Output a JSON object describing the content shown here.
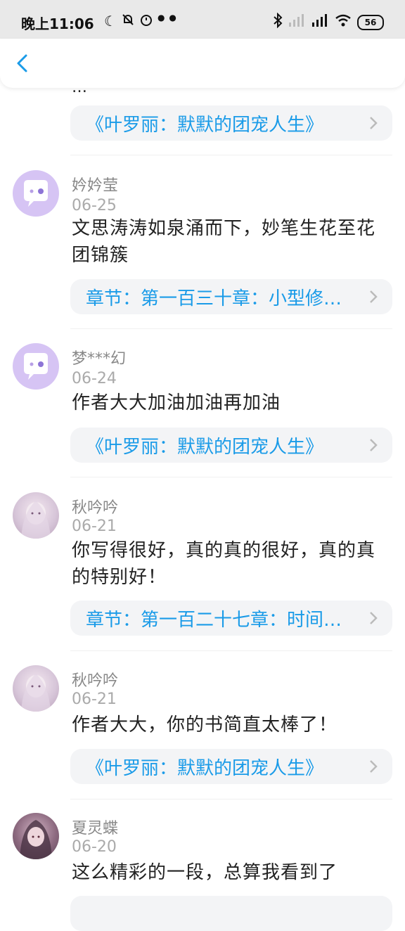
{
  "status_bar": {
    "time": "晚上11:06",
    "left_icons": [
      "moon-icon",
      "mute-bell-icon",
      "alarm-icon",
      "eye-icon",
      "eye-icon"
    ],
    "right_icons": [
      "bluetooth-icon",
      "signal-icon",
      "hd-signal-icon",
      "wifi-icon"
    ],
    "battery": "56"
  },
  "nav": {
    "back_icon": "chevron-left-icon"
  },
  "colors": {
    "link": "#1a9be8",
    "pill_bg": "#f3f4f6",
    "avatar_default": "#d6c4f4"
  },
  "top_fragment": {
    "cut_text": "…"
  },
  "first_pill": "《叶罗丽：默默的团宠人生》",
  "comments": [
    {
      "username": "妗妗莹",
      "date": "06-25",
      "text": "文思涛涛如泉涌而下，妙笔生花至花团锦簇",
      "link": "章节：第一百三十章：小型修…",
      "avatar": "default-avatar"
    },
    {
      "username": "梦***幻",
      "date": "06-24",
      "text": "作者大大加油加油再加油",
      "link": "《叶罗丽：默默的团宠人生》",
      "avatar": "default-avatar"
    },
    {
      "username": "秋吟吟",
      "date": "06-21",
      "text": "你写得很好，真的真的很好，真的真的特别好！",
      "link": "章节：第一百二十七章：时间…",
      "avatar": "photo-avatar"
    },
    {
      "username": "秋吟吟",
      "date": "06-21",
      "text": "作者大大，你的书简直太棒了！",
      "link": "《叶罗丽：默默的团宠人生》",
      "avatar": "photo-avatar"
    },
    {
      "username": "夏灵蝶",
      "date": "06-20",
      "text": "这么精彩的一段，总算我看到了",
      "avatar": "photo-avatar"
    }
  ]
}
